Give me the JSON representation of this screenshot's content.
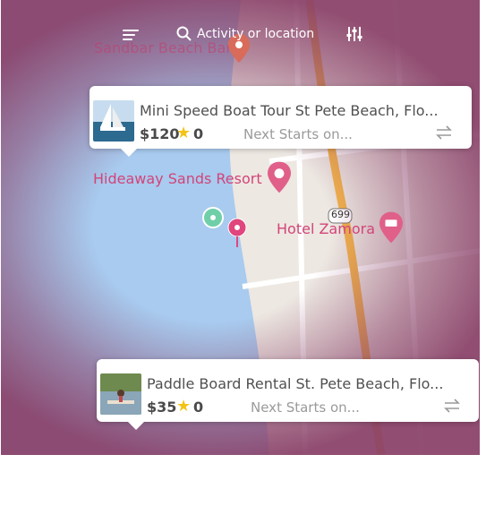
{
  "search": {
    "placeholder": "Activity or location"
  },
  "map": {
    "labels": {
      "beach_bar": "Sandbar Beach Bar",
      "resort": "Hideaway Sands Resort",
      "hotel": "Hotel Zamora",
      "route": "699"
    }
  },
  "cards": [
    {
      "title": "Mini Speed Boat Tour St Pete Beach, Flo...",
      "price": "$120",
      "rating": "0",
      "next": "Next Starts on..."
    },
    {
      "title": "Paddle Board Rental St. Pete Beach, Flo...",
      "price": "$35",
      "rating": "0",
      "next": "Next Starts on..."
    }
  ],
  "colors": {
    "overlay": "#894068",
    "label_pink": "#d34479",
    "water": "#a8cbef",
    "road_yellow": "#f2b24a",
    "star": "#f2c418",
    "marker_teal": "#6fcfa8"
  },
  "icons": [
    "menu-icon",
    "search-icon",
    "filter-icon",
    "star-icon",
    "swap-icon",
    "map-pin-icon"
  ]
}
